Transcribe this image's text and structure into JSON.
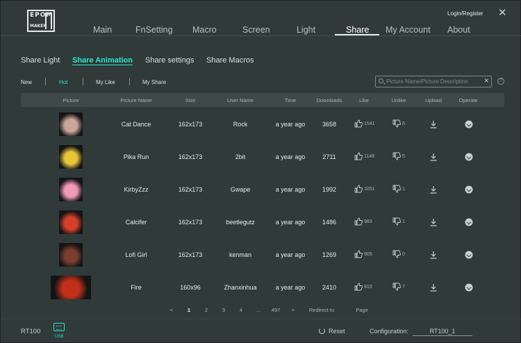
{
  "header": {
    "logo_line1": "EPOM",
    "logo_line2": "MAKER",
    "login": "Login/Register",
    "close": "✕",
    "nav": [
      "Main",
      "FnSetting",
      "Macro",
      "Screen",
      "Light",
      "Share",
      "My Account",
      "About"
    ],
    "active_nav": "Share"
  },
  "subtabs": [
    "Share Light",
    "Share Animation",
    "Share settings",
    "Share Macros"
  ],
  "active_subtab": "Share Animation",
  "filters": [
    "New",
    "Hot",
    "My Like",
    "My Share"
  ],
  "active_filter": "Hot",
  "search": {
    "placeholder": "Picture Name/Picture Description",
    "clear": "✕",
    "help": "?"
  },
  "table": {
    "columns": [
      "Picture",
      "Picture Name",
      "Size",
      "User Name",
      "Time",
      "Downloads",
      "Like",
      "Unlike",
      "Upload",
      "Operate"
    ],
    "rows": [
      {
        "name": "Cat Dance",
        "size": "162x173",
        "user": "Rock",
        "time": "a year ago",
        "downloads": "3658",
        "likes": "1541",
        "unlikes": "6",
        "thumb_color": "#c9a59a"
      },
      {
        "name": "Pika Run",
        "size": "162x173",
        "user": "2bit",
        "time": "a year ago",
        "downloads": "2711",
        "likes": "1148",
        "unlikes": "5",
        "thumb_color": "#e8c53a"
      },
      {
        "name": "KirbyZzz",
        "size": "162x173",
        "user": "Gwape",
        "time": "a year ago",
        "downloads": "1992",
        "likes": "1051",
        "unlikes": "1",
        "thumb_color": "#f09ab6"
      },
      {
        "name": "Calcifer",
        "size": "162x173",
        "user": "beetlegutz",
        "time": "a year ago",
        "downloads": "1486",
        "likes": "983",
        "unlikes": "1",
        "thumb_color": "#d6402a"
      },
      {
        "name": "Lofi Girl",
        "size": "162x173",
        "user": "kenman",
        "time": "a year ago",
        "downloads": "1269",
        "likes": "905",
        "unlikes": "0",
        "thumb_color": "#7a3f2e"
      },
      {
        "name": "Fire",
        "size": "160x96",
        "user": "Zhanxinhua",
        "time": "a year ago",
        "downloads": "2410",
        "likes": "910",
        "unlikes": "7",
        "thumb_color": "#c2301a"
      }
    ]
  },
  "pagination": {
    "prev": "<",
    "pages": [
      "1",
      "2",
      "3",
      "4",
      "...",
      "497"
    ],
    "active": "1",
    "next": ">",
    "redirect": "Redirect to",
    "page": "Page"
  },
  "footer": {
    "model": "RT100",
    "usb": "USB",
    "reset": "Reset",
    "config_label": "Configuration:",
    "config_value": "RT100_1"
  },
  "colors": {
    "accent": "#2de5d0",
    "background": "#2f3a39",
    "header_row": "#3f4a48"
  }
}
